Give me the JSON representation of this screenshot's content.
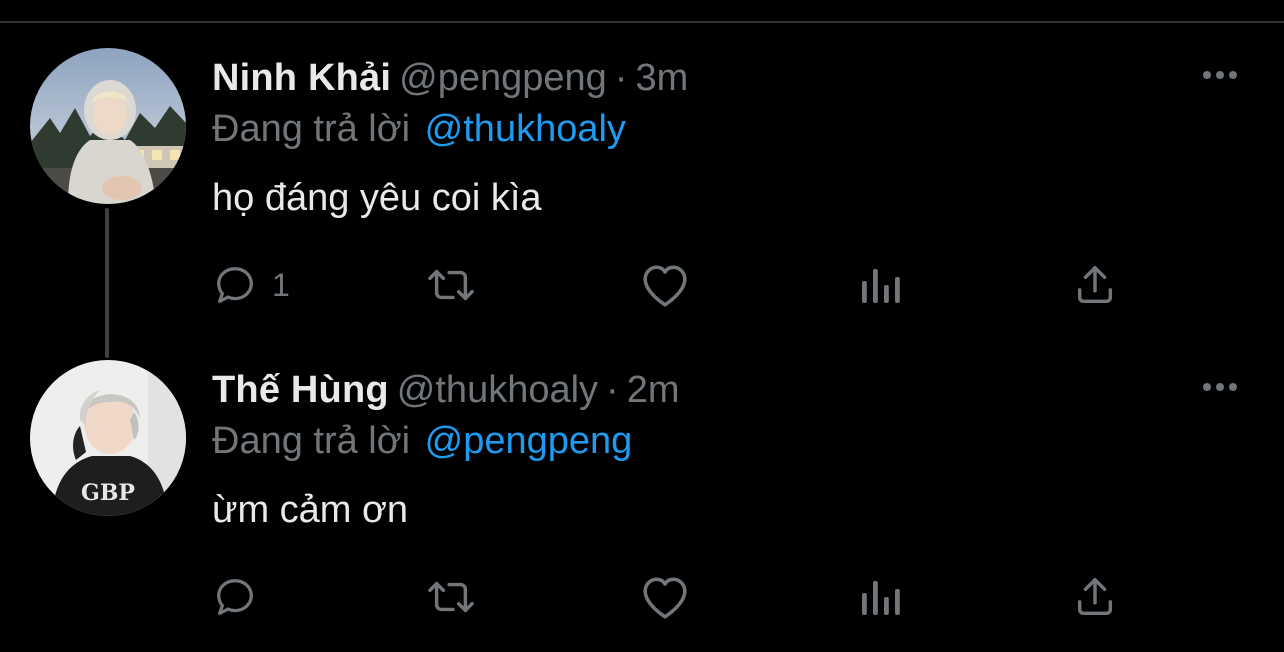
{
  "colors": {
    "background": "#000000",
    "text_primary": "#e7e9ea",
    "text_secondary": "#71767b",
    "mention": "#1d9bf0",
    "divider": "#2f3336"
  },
  "reply_prefix": "Đang trả lời",
  "tweets": [
    {
      "avatar_icon": "user-avatar-photo",
      "name": "Ninh Khải",
      "handle": "@pengpeng",
      "separator": "·",
      "time": "3m",
      "reply_to": "@thukhoaly",
      "text": "họ đáng yêu coi kìa",
      "reply_count": "1",
      "retweet_count": "",
      "like_count": ""
    },
    {
      "avatar_icon": "user-avatar-photo",
      "name": "Thế Hùng",
      "handle": "@thukhoaly",
      "separator": "·",
      "time": "2m",
      "reply_to": "@pengpeng",
      "text": "ừm cảm ơn",
      "reply_count": "",
      "retweet_count": "",
      "like_count": ""
    }
  ],
  "icons": {
    "reply": "reply-icon",
    "retweet": "retweet-icon",
    "like": "heart-icon",
    "views": "views-icon",
    "share": "share-icon",
    "more": "more-options-icon"
  }
}
